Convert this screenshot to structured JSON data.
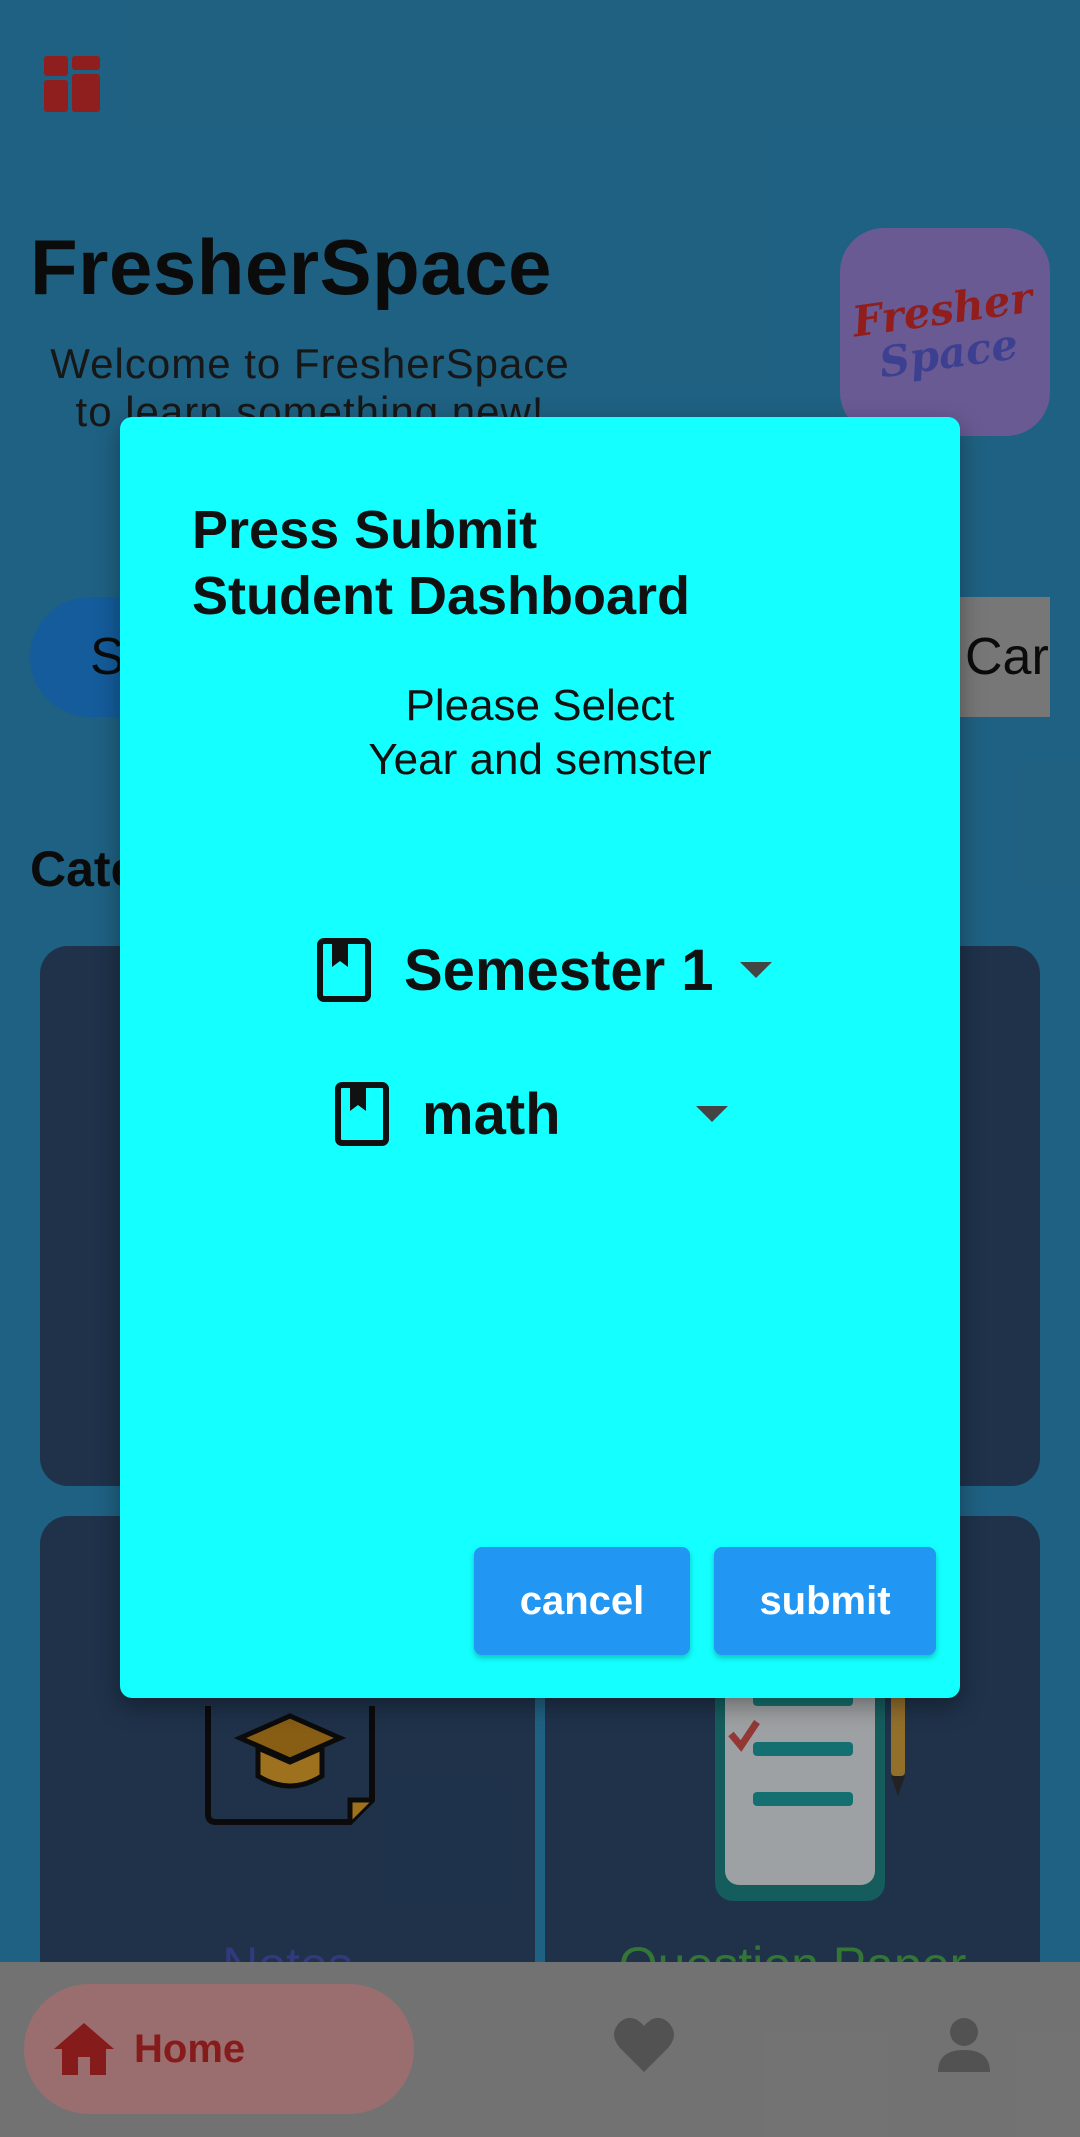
{
  "header": {
    "menu_icon": "dashboard-grid-icon",
    "app_title": "FresherSpace",
    "subtitle": "Welcome to FresherSpace to learn something new!",
    "logo": {
      "line1": "Fresher",
      "line2": "Space"
    }
  },
  "chips": {
    "left_label": "S",
    "right_label": "Care"
  },
  "categories": {
    "title": "Cate",
    "notes_label": "Notes",
    "question_paper_label": "Question Paper",
    "colors": {
      "notes": "#3f51b5",
      "question_paper": "#4caf50"
    }
  },
  "bottom_nav": {
    "home_label": "Home",
    "home_icon": "home-icon",
    "favorite_icon": "heart-icon",
    "profile_icon": "person-icon"
  },
  "dialog": {
    "title_line1": "Press Submit",
    "title_line2": "Student Dashboard",
    "message_line1": "Please Select",
    "message_line2": "Year and semster",
    "semester_dropdown": {
      "icon": "book-bookmark-icon",
      "value": "Semester 1"
    },
    "subject_dropdown": {
      "icon": "book-bookmark-icon",
      "value": "math"
    },
    "cancel_label": "cancel",
    "submit_label": "submit",
    "background_color": "#14ffff",
    "button_color": "#2196f3"
  }
}
